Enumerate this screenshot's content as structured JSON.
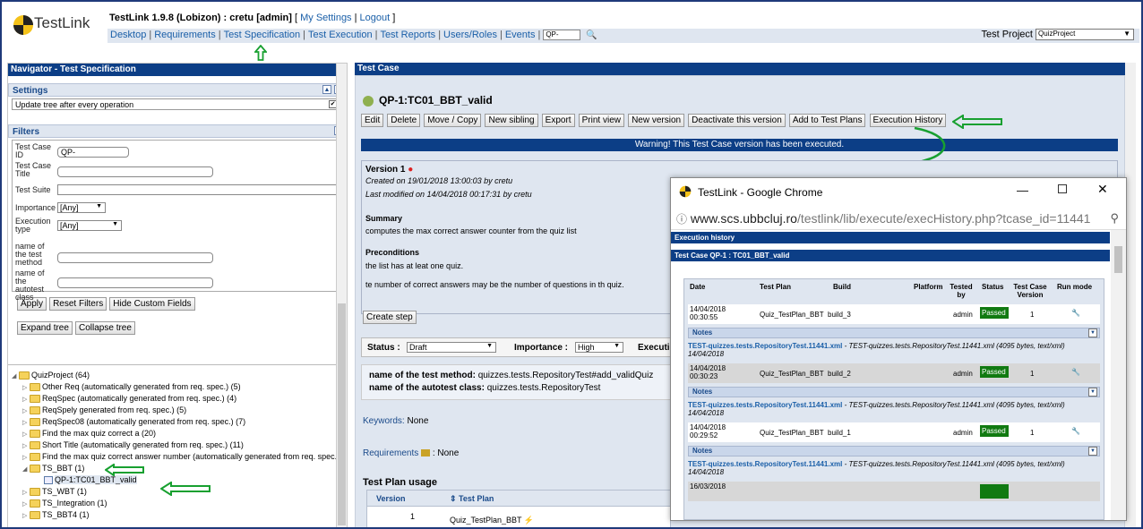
{
  "app": {
    "logo_text": "TestLink",
    "version_user": "TestLink 1.9.8 (Lobizon) : cretu [admin]",
    "my_settings": "My Settings",
    "logout": "Logout",
    "menu": [
      "Desktop",
      "Requirements",
      "Test Specification",
      "Test Execution",
      "Test Reports",
      "Users/Roles",
      "Events"
    ],
    "menu_search_value": "QP-",
    "test_project_label": "Test Project",
    "test_project_value": "QuizProject"
  },
  "left": {
    "header": "Navigator - Test Specification",
    "settings_title": "Settings",
    "settings_option": "Update tree after every operation",
    "filters_title": "Filters",
    "filters": {
      "tc_id_label": "Test Case ID",
      "tc_id_value": "QP-",
      "tc_title_label": "Test Case Title",
      "suite_label": "Test Suite",
      "importance_label": "Importance",
      "importance_value": "[Any]",
      "exec_type_label": "Execution type",
      "exec_type_value": "[Any]",
      "method_label": "name of the test method",
      "class_label": "name of the autotest class"
    },
    "buttons": {
      "apply": "Apply",
      "reset": "Reset Filters",
      "hide": "Hide Custom Fields",
      "expand": "Expand tree",
      "collapse": "Collapse tree"
    },
    "tree": [
      "QuizProject (64)",
      "Other Req (automatically generated from req. spec.) (5)",
      "ReqSpec (automatically generated from req. spec.) (4)",
      "ReqSpely generated from req. spec.) (5)",
      "ReqSpec08 (automatically generated from req. spec.) (7)",
      "Find the max quiz correct a (20)",
      "Short Title (automatically generated from req. spec.) (11)",
      "Find the max quiz correct answer number (automatically generated from req. spec.",
      "TS_BBT (1)",
      "QP-1:TC01_BBT_valid",
      "TS_WBT (1)",
      "TS_Integration (1)",
      "TS_BBT4 (1)"
    ]
  },
  "right": {
    "header": "Test Case",
    "tc_title": "QP-1:TC01_BBT_valid",
    "buttons": [
      "Edit",
      "Delete",
      "Move / Copy",
      "New sibling",
      "Export",
      "Print view",
      "New version",
      "Deactivate this version",
      "Add to Test Plans",
      "Execution History"
    ],
    "warning": "Warning! This Test Case version has been executed.",
    "version": "Version 1",
    "created": "Created on 19/01/2018 13:00:03  by cretu",
    "modified": "Last modified on  14/04/2018 00:17:31  by cretu",
    "summary_label": "Summary",
    "summary": "computes the max correct answer counter from the quiz list",
    "preconditions_label": "Preconditions",
    "preconditions": "the list has at leat one quiz.",
    "note": "te number of correct answers may be the number of questions in th quiz.",
    "create_step": "Create step",
    "status_label": "Status :",
    "status_value": "Draft",
    "importance_label": "Importance :",
    "importance_value": "High",
    "exec_label": "Executi",
    "method_label": "name of the test method:",
    "method_value": "quizzes.tests.RepositoryTest#add_validQuiz",
    "class_label": "name of the autotest class:",
    "class_value": "quizzes.tests.RepositoryTest",
    "keywords_label": "Keywords:",
    "keywords_value": "None",
    "requirements_label": "Requirements",
    "requirements_value": ": None",
    "testplan_usage": "Test Plan usage",
    "tp_col_version": "Version",
    "tp_col_plan": "Test Plan",
    "tp_row_version": "1",
    "tp_row_plan": "Quiz_TestPlan_BBT"
  },
  "popup": {
    "window_title": "TestLink - Google Chrome",
    "url_host": "www.scs.ubbcluj.ro",
    "url_path": "/testlink/lib/execute/execHistory.php?tcase_id=11441",
    "bar1": "Execution history",
    "bar2": "Test Case QP-1 : TC01_BBT_valid",
    "columns": [
      "Date",
      "Test Plan",
      "Build",
      "Platform",
      "Tested by",
      "Status",
      "Test Case Version",
      "Run mode"
    ],
    "rows": [
      {
        "date": "14/04/2018 00:30:55",
        "plan": "Quiz_TestPlan_BBT",
        "build": "build_3",
        "tested_by": "admin",
        "status": "Passed",
        "version": "1"
      },
      {
        "date": "14/04/2018 00:30:23",
        "plan": "Quiz_TestPlan_BBT",
        "build": "build_2",
        "tested_by": "admin",
        "status": "Passed",
        "version": "1"
      },
      {
        "date": "14/04/2018 00:29:52",
        "plan": "Quiz_TestPlan_BBT",
        "build": "build_1",
        "tested_by": "admin",
        "status": "Passed",
        "version": "1"
      },
      {
        "date": "16/03/2018",
        "plan": "",
        "build": "",
        "tested_by": "",
        "status": "",
        "version": ""
      }
    ],
    "notes_label": "Notes",
    "note_link": "TEST-quizzes.tests.RepositoryTest.11441.xml",
    "note_rest": " - TEST-quizzes.tests.RepositoryTest.11441.xml (4095 bytes, text/xml) 14/04/2018"
  },
  "colors": {
    "nav_blue": "#0c3e86",
    "panel_bg": "#dfe6f0",
    "passed": "#117a11",
    "arrow_green": "#18a030"
  }
}
